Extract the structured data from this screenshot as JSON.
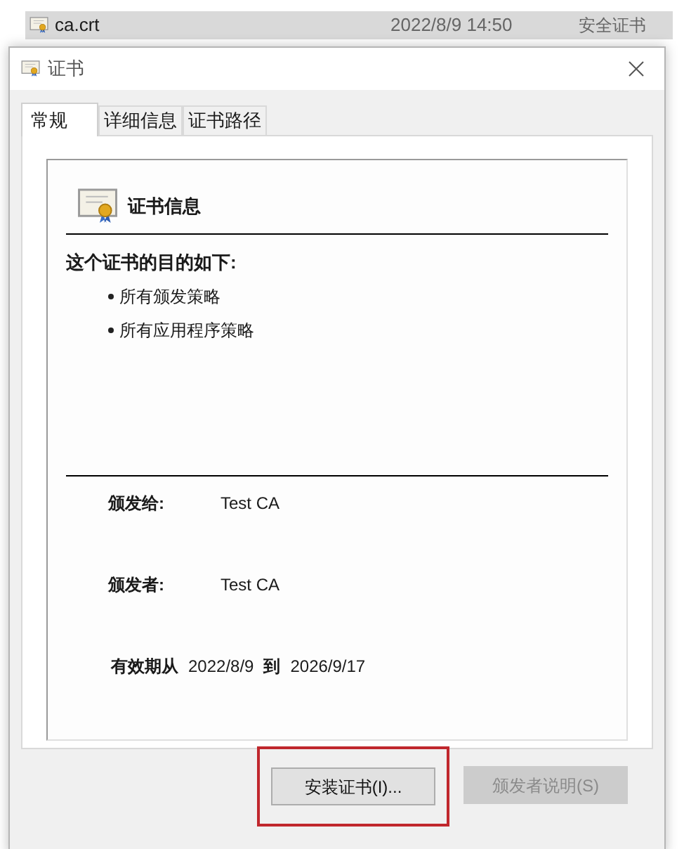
{
  "file_row": {
    "name": "ca.crt",
    "date": "2022/8/9 14:50",
    "type": "安全证书"
  },
  "window": {
    "title": "证书"
  },
  "tabs": [
    {
      "label": "常规",
      "selected": true
    },
    {
      "label": "详细信息",
      "selected": false
    },
    {
      "label": "证书路径",
      "selected": false
    }
  ],
  "info": {
    "heading": "证书信息",
    "purpose_title": "这个证书的目的如下:",
    "purposes": [
      "所有颁发策略",
      "所有应用程序策略"
    ],
    "issued_to": {
      "label": "颁发给:",
      "value": "Test CA"
    },
    "issued_by": {
      "label": "颁发者:",
      "value": "Test CA"
    },
    "validity": {
      "label": "有效期从",
      "from": "2022/8/9",
      "to_label": "到",
      "to": "2026/9/17"
    }
  },
  "buttons": [
    {
      "label": "安装证书(I)...",
      "disabled": false,
      "highlighted": true
    },
    {
      "label": "颁发者说明(S)",
      "disabled": true,
      "highlighted": false
    }
  ]
}
